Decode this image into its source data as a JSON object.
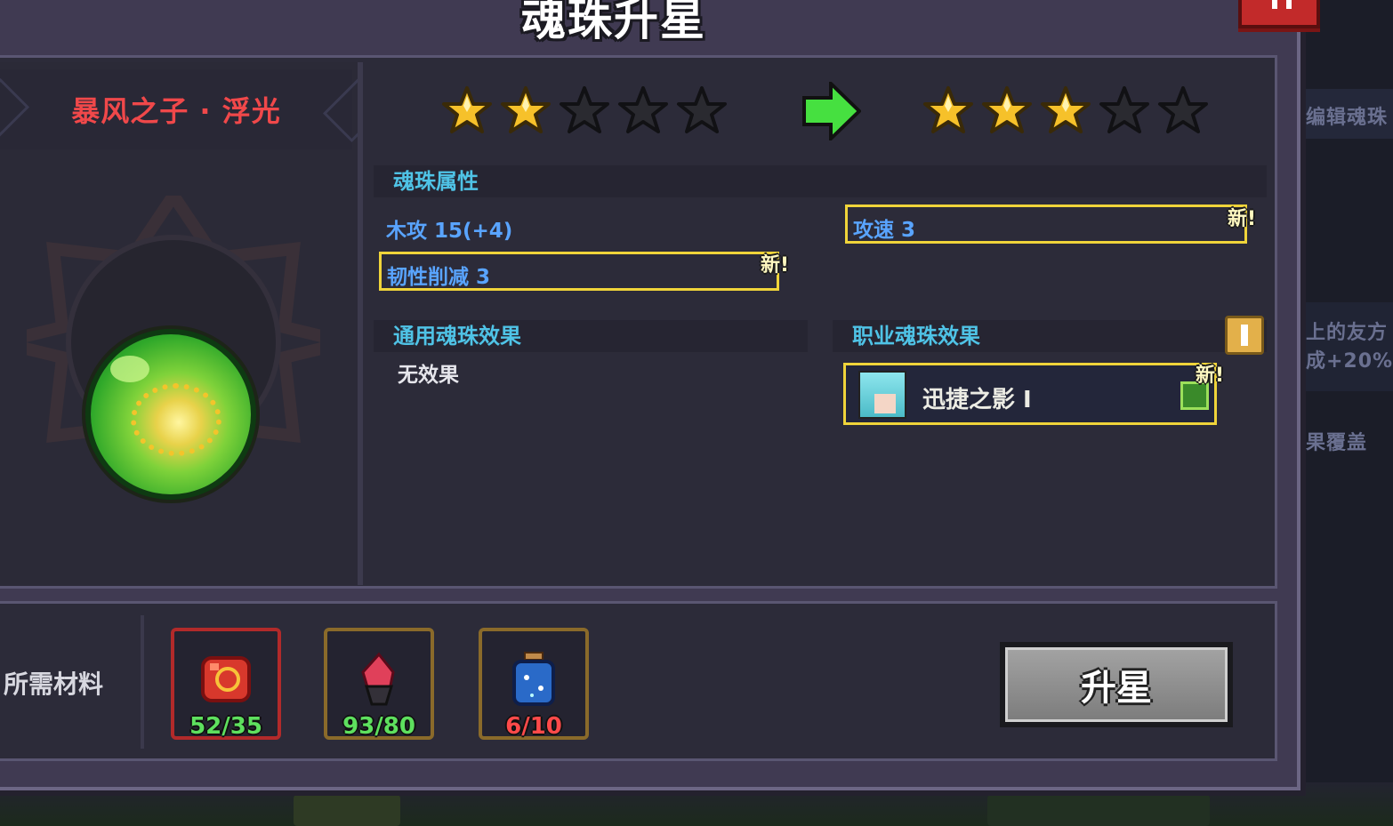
{
  "title": "魂珠升星",
  "gem": {
    "name": "暴风之子 · 浮光"
  },
  "stars": {
    "current": 2,
    "next": 3,
    "max": 5
  },
  "attributes": {
    "header": "魂珠属性",
    "items": [
      {
        "text": "木攻 15(+4)",
        "is_new": false
      },
      {
        "text": "攻速 3",
        "is_new": true
      },
      {
        "text": "韧性削减 3",
        "is_new": true
      }
    ],
    "new_label": "新!"
  },
  "effects": {
    "general_header": "通用魂珠效果",
    "general_value": "无效果",
    "class_header": "职业魂珠效果",
    "class_skill": "迅捷之影 Ⅰ",
    "class_new_label": "新!"
  },
  "materials": {
    "label": "所需材料",
    "items": [
      {
        "count": "52/35",
        "count_color": "#5ee05e",
        "icon": "red-rune-icon"
      },
      {
        "count": "93/80",
        "count_color": "#5ee05e",
        "icon": "crystal-icon"
      },
      {
        "count": "6/10",
        "count_color": "#ff4a4a",
        "icon": "star-jar-icon"
      }
    ]
  },
  "upgrade_button": "升星",
  "background_texts": [
    "编辑魂珠",
    "上的友方",
    "成+20%，",
    "果覆盖"
  ],
  "colors": {
    "star_filled": "#f6c12a",
    "star_empty": "#2a2a30",
    "accent_new_border": "#f0d43a",
    "attr_text": "#59a4ff",
    "section_header": "#4fc3e6",
    "gem_name": "#f0484a"
  }
}
